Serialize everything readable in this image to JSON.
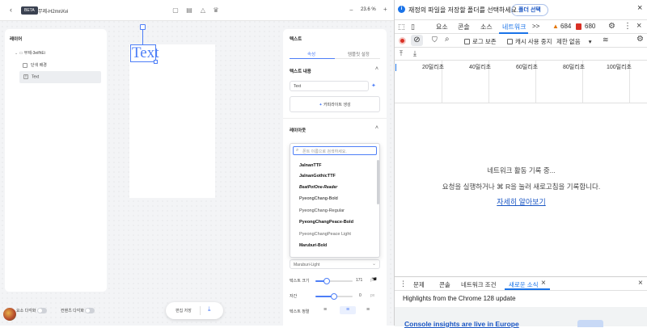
{
  "app": {
    "badge": "BETA",
    "doc_name": "무제-H2mnXvi",
    "zoom": "23.6 %",
    "layers": {
      "title": "레이어",
      "root": "무제-3eifhEi",
      "items": [
        "단색 배경",
        "Text"
      ]
    },
    "canvas_text": "Text",
    "props": {
      "title": "텍스트",
      "tabs": [
        "속성",
        "템플릿 설정"
      ],
      "text_content_title": "텍스트 내용",
      "text_value": "Text",
      "copywrite_label": "카피라이트 생성",
      "layout_title": "레이아웃",
      "font_search_placeholder": "폰트 이름으로 검색하세요.",
      "fonts": [
        "JalnanTTF",
        "JalnanGothicTTF",
        "BeatPotOne-Reader",
        "PyeongChang-Bold",
        "PyeongChang-Regular",
        "PyeongChangPeace-Bold",
        "PyeongChangPeace Light",
        "Maruburi-Bold"
      ],
      "selected_font": "Maruburi-Light",
      "size_label": "텍스트 크기",
      "size_value": "171",
      "size_unit": "px",
      "size_fraction": 0.3,
      "spacing_label": "자간",
      "spacing_value": "0",
      "spacing_unit": "px",
      "spacing_fraction": 0.5,
      "align_label": "텍스트 정렬"
    },
    "bottom": {
      "toggle1": "요소 다각화",
      "toggle2": "컨텐츠 다각화",
      "save": "편집 저장"
    }
  },
  "devtools": {
    "info": "재정의 파일을 저장할 폴더를 선택하세요.",
    "folder_button": "폴더 선택",
    "tabs": [
      "요소",
      "콘솔",
      "소스",
      "네트워크"
    ],
    "more": ">>",
    "warn_count": "684",
    "err_count": "680",
    "net_opts": {
      "preserve_log": "로그 보존",
      "disable_cache": "캐시 사용 중지",
      "throttle": "제한 없음"
    },
    "ticks": [
      "20밀리초",
      "40밀리초",
      "60밀리초",
      "80밀리초",
      "100밀리초"
    ],
    "empty_line1": "네트워크 활동 기록 중...",
    "empty_line2": "요청을 실행하거나 ⌘ R을 눌러 새로고침을 기록합니다.",
    "learn_more": "자세히 알아보기",
    "drawer_tabs": [
      "문제",
      "콘솔",
      "네트워크 조건",
      "새로운 소식"
    ],
    "highlights": "Highlights from the Chrome 128 update",
    "console_insights": "Console insights are live in Europe"
  },
  "colors": {
    "accent": "#4d7ef7",
    "devtools_active": "#1a73e8"
  }
}
